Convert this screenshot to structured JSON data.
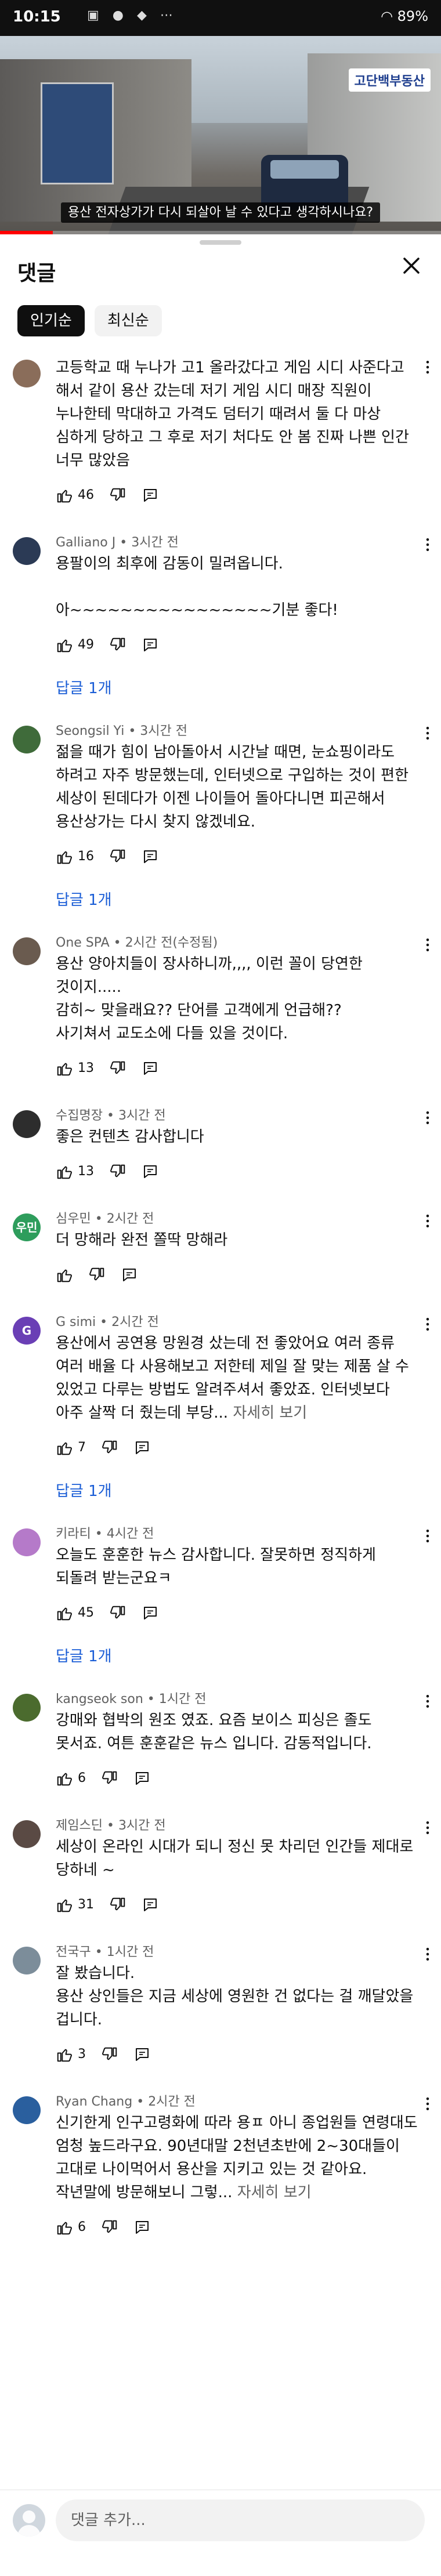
{
  "status_bar": {
    "time": "10:15",
    "battery": "89%"
  },
  "video": {
    "channel_badge": "고단백부동산",
    "caption": "용산 전자상가가 다시 되살아 날 수 있다고 생각하시나요?",
    "progress_fraction": 0.12
  },
  "panel": {
    "title": "댓글",
    "tabs": [
      {
        "label": "인기순",
        "active": true
      },
      {
        "label": "최신순",
        "active": false
      }
    ]
  },
  "comments": [
    {
      "author": "",
      "time": "",
      "text": "고등학교 때 누나가 고1 올라갔다고 게임 시디 사준다고 해서 같이 용산 갔는데 저기 게임 시디 매장 직원이 누나한테 막대하고 가격도 덤터기 때려서 둘 다 마상 심하게 당하고 그 후로 저기 처다도 안 봄 진짜 나쁜 인간 너무 많았음",
      "more": "",
      "likes": "46",
      "replies": "",
      "avatar_color": "#8a6d5a",
      "avatar_letter": ""
    },
    {
      "author": "Galliano J",
      "time": "3시간 전",
      "text": "용팔이의 최후에 감동이 밀려옵니다.\n\n아~~~~~~~~~~~~~~~~기분 좋다!",
      "more": "",
      "likes": "49",
      "replies": "답글 1개",
      "avatar_color": "#2b3a55",
      "avatar_letter": ""
    },
    {
      "author": "Seongsil Yi",
      "time": "3시간 전",
      "text": "젊을 때가 힘이 남아돌아서 시간날 때면, 눈쇼핑이라도 하려고 자주 방문했는데, 인터넷으로 구입하는 것이 편한 세상이 된데다가 이젠 나이들어 돌아다니면 피곤해서 용산상가는 다시 찾지 않겠네요.",
      "more": "",
      "likes": "16",
      "replies": "답글 1개",
      "avatar_color": "#3f6b3a",
      "avatar_letter": ""
    },
    {
      "author": "One SPA",
      "time": "2시간 전(수정됨)",
      "text": "용산 양아치들이 장사하니까,,,, 이런 꼴이 당연한 것이지.....\n감히~ 맞을래요?? 단어를 고객에게 언급해??\n사기쳐서 교도소에 다들 있을 것이다.",
      "more": "",
      "likes": "13",
      "replies": "",
      "avatar_color": "#6a5b4f",
      "avatar_letter": ""
    },
    {
      "author": "수집명장",
      "time": "3시간 전",
      "text": "좋은 컨텐츠 감사합니다",
      "more": "",
      "likes": "13",
      "replies": "",
      "avatar_color": "#2d2d2d",
      "avatar_letter": ""
    },
    {
      "author": "심우민",
      "time": "2시간 전",
      "text": "더 망해라 완전 쫄딱 망해라",
      "more": "",
      "likes": "",
      "replies": "",
      "avatar_color": "#2e9d5c",
      "avatar_letter": "우민"
    },
    {
      "author": "G simi",
      "time": "2시간 전",
      "text": "용산에서 공연용 망원경 샀는데 전 좋았어요 여러 종류 여러 배율 다 사용해보고 저한테 제일 잘 맞는 제품 살 수 있었고 다루는 방법도 알려주셔서 좋았죠. 인터넷보다 아주 살짝 더 줬는데 부당...",
      "more": "자세히 보기",
      "likes": "7",
      "replies": "답글 1개",
      "avatar_color": "#6a3fb5",
      "avatar_letter": "G"
    },
    {
      "author": "키라티",
      "time": "4시간 전",
      "text": "오늘도 훈훈한 뉴스 감사합니다. 잘못하면 정직하게 되돌려 받는군요ㅋ",
      "more": "",
      "likes": "45",
      "replies": "답글 1개",
      "avatar_color": "#b57ac9",
      "avatar_letter": ""
    },
    {
      "author": "kangseok son",
      "time": "1시간 전",
      "text": "강매와 협박의 원조 였죠. 요즘 보이스 피싱은 졸도 못서죠. 여튼 훈훈같은 뉴스 입니다. 감동적입니다.",
      "more": "",
      "likes": "6",
      "replies": "",
      "avatar_color": "#4b6b2e",
      "avatar_letter": ""
    },
    {
      "author": "제임스딘",
      "time": "3시간 전",
      "text": "세상이 온라인 시대가 되니 정신 못 차리던 인간들 제대로 당하네 ~",
      "more": "",
      "likes": "31",
      "replies": "",
      "avatar_color": "#5a4a44",
      "avatar_letter": ""
    },
    {
      "author": "전국구",
      "time": "1시간 전",
      "text": "잘 봤습니다.\n용산 상인들은 지금 세상에 영원한 건 없다는 걸 깨달았을 겁니다.",
      "more": "",
      "likes": "3",
      "replies": "",
      "avatar_color": "#7c8d9a",
      "avatar_letter": ""
    },
    {
      "author": "Ryan Chang",
      "time": "2시간 전",
      "text": "신기한게 인구고령화에 따라 용ㅍ 아니 종업원들 연령대도 엄청 높드라구요. 90년대말 2천년초반에 2~30대들이 고대로 나이먹어서 용산을 지키고 있는 것 같아요. 작년말에 방문해보니 그렇...",
      "more": "자세히 보기",
      "likes": "6",
      "replies": "",
      "avatar_color": "#2a5f9e",
      "avatar_letter": ""
    }
  ],
  "add_comment": {
    "placeholder": "댓글 추가..."
  }
}
